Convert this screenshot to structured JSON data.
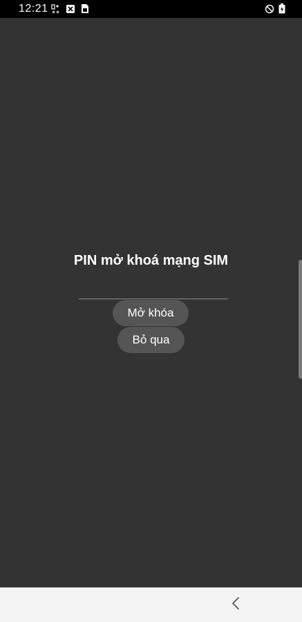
{
  "status_bar": {
    "time": "12:21",
    "icons_left": [
      "data-transfer-icon",
      "nfc-x-icon",
      "sim-card-icon"
    ],
    "icons_right": [
      "do-not-disturb-icon",
      "battery-charging-icon"
    ]
  },
  "dialog": {
    "title": "PIN mở khoá mạng SIM",
    "pin_value": "",
    "unlock_label": "Mở khóa",
    "skip_label": "Bỏ qua"
  },
  "colors": {
    "background": "#333333",
    "button": "#555555",
    "nav_bar": "#f4f4f4"
  }
}
